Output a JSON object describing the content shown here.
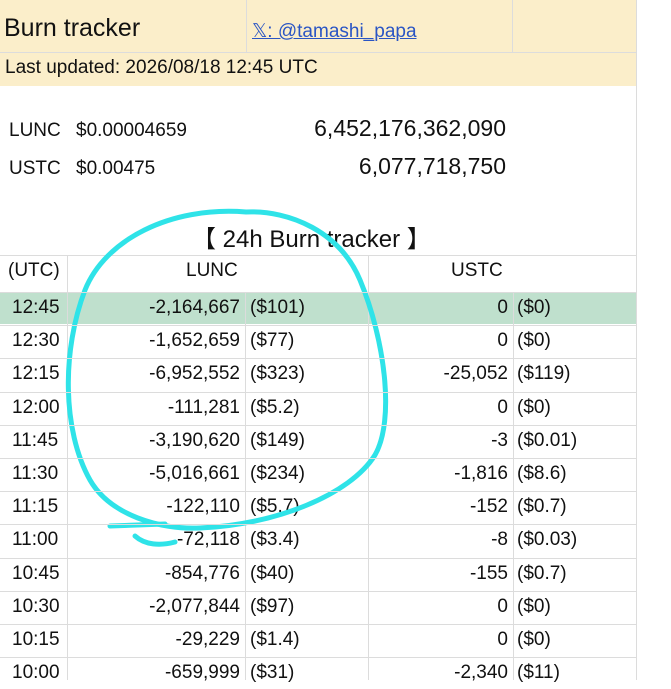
{
  "header": {
    "title": "Burn tracker",
    "handle": "𝕏: @tamashi_papa",
    "last_updated": "Last updated: 2026/08/18 12:45 UTC"
  },
  "prices": [
    {
      "symbol": "LUNC",
      "price": "$0.00004659",
      "supply": "6,452,176,362,090"
    },
    {
      "symbol": "USTC",
      "price": "$0.00475",
      "supply": "6,077,718,750"
    }
  ],
  "tracker": {
    "title": "【 24h Burn tracker 】",
    "headers": {
      "time": "(UTC)",
      "lunc": "LUNC",
      "ustc": "USTC"
    },
    "rows": [
      {
        "time": "12:45",
        "lunc": "-2,164,667",
        "lunc_usd": "($101)",
        "ustc": "0",
        "ustc_usd": "($0)"
      },
      {
        "time": "12:30",
        "lunc": "-1,652,659",
        "lunc_usd": "($77)",
        "ustc": "0",
        "ustc_usd": "($0)"
      },
      {
        "time": "12:15",
        "lunc": "-6,952,552",
        "lunc_usd": "($323)",
        "ustc": "-25,052",
        "ustc_usd": "($119)"
      },
      {
        "time": "12:00",
        "lunc": "-111,281",
        "lunc_usd": "($5.2)",
        "ustc": "0",
        "ustc_usd": "($0)"
      },
      {
        "time": "11:45",
        "lunc": "-3,190,620",
        "lunc_usd": "($149)",
        "ustc": "-3",
        "ustc_usd": "($0.01)"
      },
      {
        "time": "11:30",
        "lunc": "-5,016,661",
        "lunc_usd": "($234)",
        "ustc": "-1,816",
        "ustc_usd": "($8.6)"
      },
      {
        "time": "11:15",
        "lunc": "-122,110",
        "lunc_usd": "($5.7)",
        "ustc": "-152",
        "ustc_usd": "($0.7)"
      },
      {
        "time": "11:00",
        "lunc": "-72,118",
        "lunc_usd": "($3.4)",
        "ustc": "-8",
        "ustc_usd": "($0.03)"
      },
      {
        "time": "10:45",
        "lunc": "-854,776",
        "lunc_usd": "($40)",
        "ustc": "-155",
        "ustc_usd": "($0.7)"
      },
      {
        "time": "10:30",
        "lunc": "-2,077,844",
        "lunc_usd": "($97)",
        "ustc": "0",
        "ustc_usd": "($0)"
      },
      {
        "time": "10:15",
        "lunc": "-29,229",
        "lunc_usd": "($1.4)",
        "ustc": "0",
        "ustc_usd": "($0)"
      },
      {
        "time": "10:00",
        "lunc": "-659,999",
        "lunc_usd": "($31)",
        "ustc": "-2,340",
        "ustc_usd": "($11)"
      }
    ]
  },
  "colors": {
    "header_bg": "#fbeeca",
    "highlight_row": "#bfe0cd",
    "handle_link": "#2a55c4",
    "annotation_stroke": "#2fe3e8"
  }
}
